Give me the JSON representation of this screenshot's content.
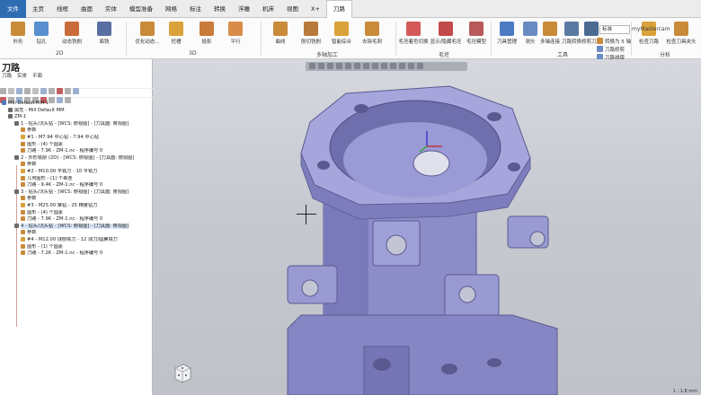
{
  "window": {
    "product": "myMastercam",
    "config": "标准"
  },
  "tabs": [
    {
      "label": "文件",
      "active": false,
      "file": true
    },
    {
      "label": "主页"
    },
    {
      "label": "线框"
    },
    {
      "label": "曲面"
    },
    {
      "label": "实体"
    },
    {
      "label": "模型准备"
    },
    {
      "label": "网格"
    },
    {
      "label": "标注"
    },
    {
      "label": "转换"
    },
    {
      "label": "浮雕"
    },
    {
      "label": "机床"
    },
    {
      "label": "视图"
    },
    {
      "label": "X+"
    },
    {
      "label": "刀路",
      "active": true
    }
  ],
  "ribbon": {
    "groups": {
      "g2d": "2D",
      "g3d": "3D",
      "multiaxis": "多轴加工",
      "stock": "毛坯",
      "tools": "工具",
      "analysis": "分析"
    },
    "buttons": {
      "contour": "外形",
      "drill": "钻孔",
      "dynamic_mill": "动态铣削",
      "face": "面铣",
      "optirough": "优化动态...",
      "pocket": "挖槽",
      "project": "投影",
      "parallel": "平行",
      "curve": "曲线",
      "deburr": "去除毛刺",
      "tool_manager": "刀具管理",
      "probe": "测头",
      "multi_link": "多轴连接",
      "toolpath_transform": "刀路转换",
      "trim_toolpath": "修剪刀路",
      "check_toolpath": "检查刀路",
      "check_holder": "检查刀具夹头"
    },
    "small": {
      "swarf": "刨切铣削",
      "unified": "智能综合",
      "stock_shading": "毛坯着色切换",
      "show_hide_stock": "显示/隐藏毛坯",
      "stock_model": "毛坯模型",
      "convert_5axis": "转换为 5 轴",
      "toolpath_edit": "刀路修剪",
      "toolpath_nest": "刀路排版"
    }
  },
  "panel": {
    "title": "刀路",
    "tabs": [
      "刀路",
      "实体",
      "平面"
    ],
    "tree": [
      {
        "text": "Mill Default MM-1",
        "indent": 0
      },
      {
        "text": "属性 - Mill Default MM",
        "indent": 1
      },
      {
        "text": "ZM-1",
        "indent": 1
      },
      {
        "text": "1 - 钻头/沉头钻 - [WCS: 俯视图] - [刀具面: 俯视图]",
        "indent": 2
      },
      {
        "text": "参数",
        "indent": 3
      },
      {
        "text": "#1 - M7.94 中心钻 - 7.94 中心钻",
        "indent": 3
      },
      {
        "text": "图形 - (4) 个圆素",
        "indent": 3
      },
      {
        "text": "刀路 - 7.9K - ZM-1.nc - 程序编号 0",
        "indent": 3
      },
      {
        "text": "2 - 外形铣削 (2D) - [WCS: 俯视图] - [刀具面: 俯视图]",
        "indent": 2
      },
      {
        "text": "参数",
        "indent": 3
      },
      {
        "text": "#2 - M10.00 平铣刀 - 10 平铣刀",
        "indent": 3
      },
      {
        "text": "几何图形 - (1) 个串连",
        "indent": 3
      },
      {
        "text": "刀路 - 9.4K - ZM-1.nc - 程序编号 0",
        "indent": 3
      },
      {
        "text": "3 - 钻头/沉头钻 - [WCS: 俯视图] - [刀具面: 俯视图]",
        "indent": 2
      },
      {
        "text": "参数",
        "indent": 3
      },
      {
        "text": "#3 - M25.00 锥钻 - 25 精度钻刀",
        "indent": 3
      },
      {
        "text": "图形 - (4) 个圆素",
        "indent": 3
      },
      {
        "text": "刀路 - 7.9K - ZM-1.nc - 程序编号 0",
        "indent": 3
      },
      {
        "text": "4 - 钻头/沉头钻 - [WCS: 俯视图] - [刀具面: 俯视图]",
        "indent": 2,
        "selected": true
      },
      {
        "text": "参数",
        "indent": 3
      },
      {
        "text": "#4 - M12.00 球刨铣刀 - 12 球刀/圆鼻铣刀",
        "indent": 3
      },
      {
        "text": "图形 - (1) 个圆素",
        "indent": 3
      },
      {
        "text": "刀路 - 7.2K - ZM-1.nc - 程序编号 0",
        "indent": 3
      }
    ]
  },
  "viewport": {
    "status_text": "1 : 1.8 mm"
  },
  "colors": {
    "part": "#8f8fd0",
    "accent": "#2f6db3",
    "selection": "#d9e7f7"
  }
}
